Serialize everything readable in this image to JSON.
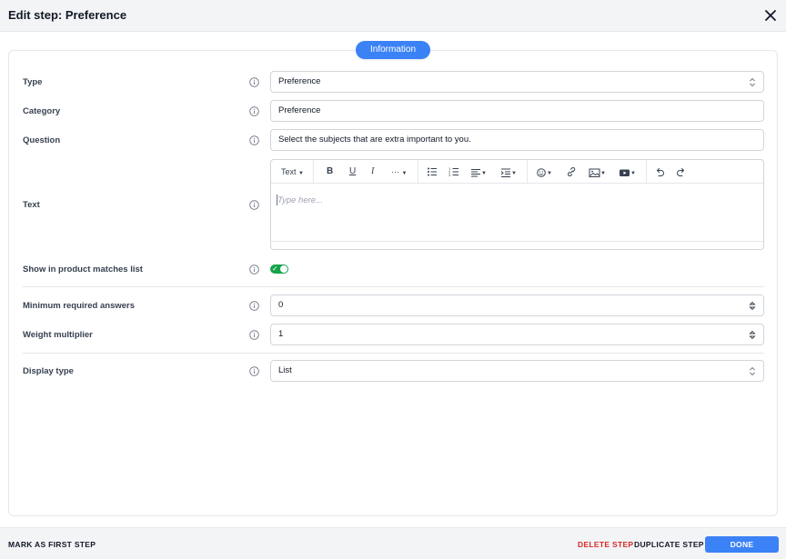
{
  "header": {
    "title": "Edit step: Preference",
    "close_icon": "close-icon"
  },
  "tabs": [
    {
      "label": "Information",
      "active": true
    }
  ],
  "form": {
    "type": {
      "label": "Type",
      "value": "Preference"
    },
    "category": {
      "label": "Category",
      "value": "Preference"
    },
    "question": {
      "label": "Question",
      "value": "Select the subjects that are extra important to you."
    },
    "text": {
      "label": "Text",
      "placeholder": "Type here...",
      "toolbar": {
        "format_label": "Text",
        "more_label": "···"
      }
    },
    "show_in_list": {
      "label": "Show in product matches list",
      "checked": true
    },
    "min_answers": {
      "label": "Minimum required answers",
      "value": "0"
    },
    "weight": {
      "label": "Weight multiplier",
      "value": "1"
    },
    "display_type": {
      "label": "Display type",
      "value": "List"
    }
  },
  "footer": {
    "mark_first": "MARK AS FIRST STEP",
    "delete": "DELETE STEP",
    "duplicate": "DUPLICATE STEP",
    "done": "DONE"
  },
  "colors": {
    "accent": "#3b82f6",
    "danger": "#dc2626",
    "toggle_on": "#16a34a"
  }
}
